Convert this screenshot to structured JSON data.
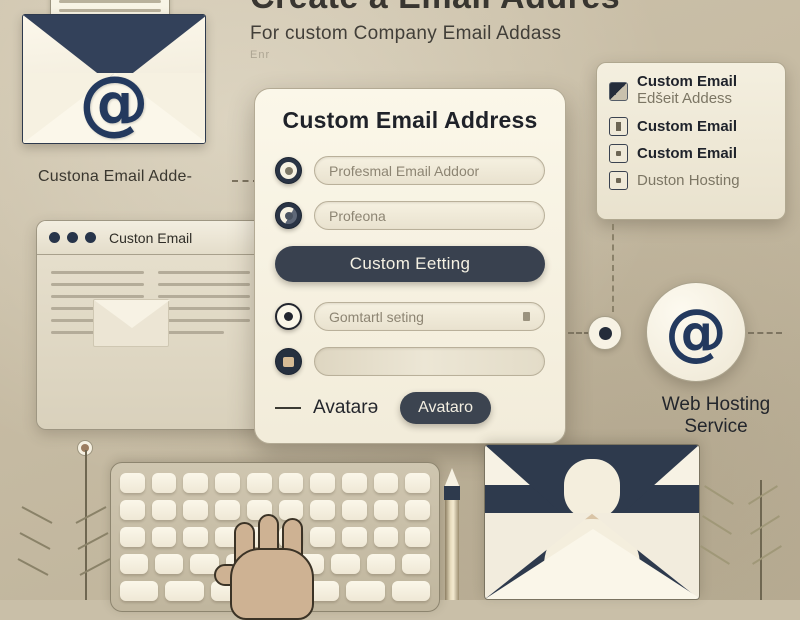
{
  "headline": {
    "title": "Create a Email Addres",
    "subtitle": "For custom Company Email Addass",
    "ghost": "Enr"
  },
  "left_caption": "Custona Email Adde-",
  "browser": {
    "title": "Custon Email",
    "dots": 3,
    "icon": "envelope-icon"
  },
  "card": {
    "title": "Custom Email Address",
    "rows": [
      {
        "radio": "selected",
        "value": "Profesmal Email Addoor"
      },
      {
        "radio": "half",
        "value": "Profeona"
      }
    ],
    "cta_label": "Custom Eetting",
    "rows2": [
      {
        "radio": "outline",
        "value": "Gomtartl seting",
        "trailing_icon": "lock-icon"
      },
      {
        "radio": "solid",
        "value": ""
      }
    ],
    "footer": {
      "label": "Avatarə",
      "button_label": "Avataro"
    }
  },
  "right_panel": {
    "items": [
      {
        "icon": "checkbox-half-icon",
        "label": "Custom Email",
        "label2": "Edšeit Addess"
      },
      {
        "icon": "checkbox-icon",
        "label": "Custom Email"
      },
      {
        "icon": "checkbox-dot-icon",
        "label": "Custom Email"
      },
      {
        "icon": "checkbox-dot-icon",
        "label": "Duston Hosting"
      }
    ]
  },
  "at_symbol": "@",
  "envelope_at_symbol": "@",
  "hosting_label_line1": "Web Hosting",
  "hosting_label_line2": "Service",
  "colors": {
    "background": "#c9bfa8",
    "card": "#fbf7e9",
    "navy": "#2e3a4d",
    "at_blue": "#23395e",
    "dark_button": "#39414f",
    "text": "#23262c"
  }
}
